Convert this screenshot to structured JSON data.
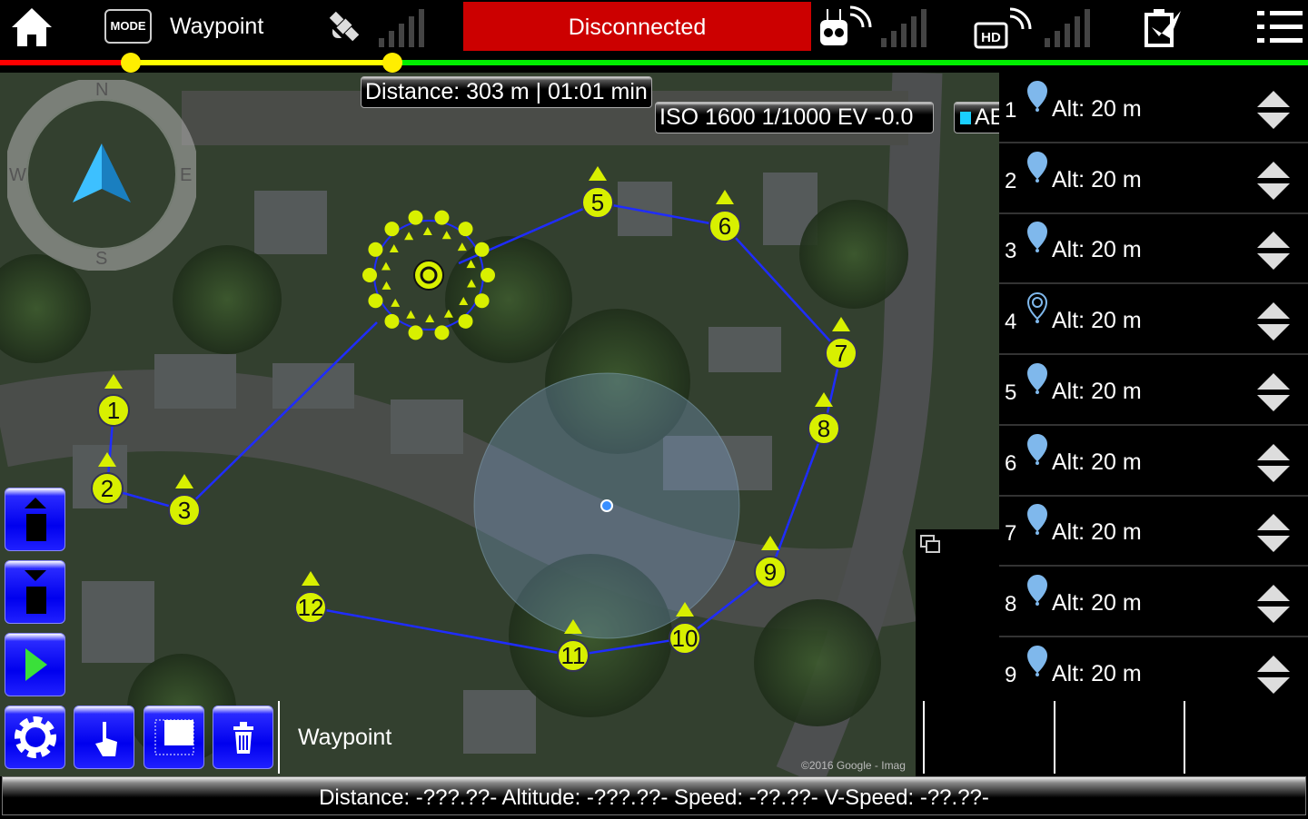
{
  "topbar": {
    "mode_icon_label": "MODE",
    "mode": "Waypoint",
    "connection_status": "Disconnected",
    "connection_color": "#cc0000"
  },
  "map": {
    "distance_info": "Distance: 303 m | 01:01 min",
    "camera_info": "ISO  1600  1/1000  EV -0.0",
    "ae_label": "AE",
    "compass": {
      "n": "N",
      "e": "E",
      "s": "S",
      "w": "W"
    },
    "attribution": "©2016 Google - Imag",
    "waypoints": [
      "1",
      "2",
      "3",
      "5",
      "6",
      "7",
      "8",
      "9",
      "10",
      "11",
      "12"
    ]
  },
  "waypoint_list": [
    {
      "n": "1",
      "alt": "Alt: 20 m",
      "icon": "pin"
    },
    {
      "n": "2",
      "alt": "Alt: 20 m",
      "icon": "pin"
    },
    {
      "n": "3",
      "alt": "Alt: 20 m",
      "icon": "pin"
    },
    {
      "n": "4",
      "alt": "Alt: 20 m",
      "icon": "orbit-pin"
    },
    {
      "n": "5",
      "alt": "Alt: 20 m",
      "icon": "pin"
    },
    {
      "n": "6",
      "alt": "Alt: 20 m",
      "icon": "pin"
    },
    {
      "n": "7",
      "alt": "Alt: 20 m",
      "icon": "pin"
    },
    {
      "n": "8",
      "alt": "Alt: 20 m",
      "icon": "pin"
    },
    {
      "n": "9",
      "alt": "Alt: 20 m",
      "icon": "pin"
    }
  ],
  "bottom": {
    "mode_label": "Waypoint"
  },
  "status_bar": "Distance: -???.??- Altitude: -???.??- Speed: -??.??- V-Speed: -??.??-"
}
